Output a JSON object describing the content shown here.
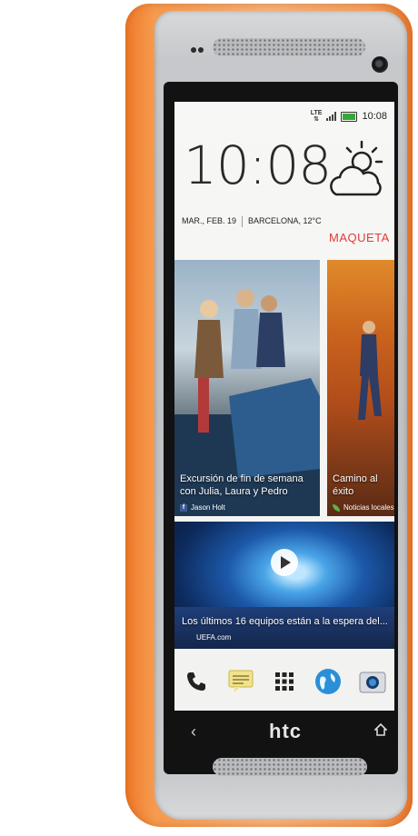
{
  "device": {
    "brand": "htc",
    "case_color": "#f08a3a"
  },
  "statusbar": {
    "network": "LTE",
    "time": "10:08",
    "battery_color": "#36a836"
  },
  "clock_widget": {
    "time": "10:08",
    "date": "MAR., FEB. 19",
    "location_temp": "BARCELONA, 12°C",
    "weather_label": "MAQUETA",
    "weather_icon": "partly-cloudy-icon"
  },
  "news_tiles": [
    {
      "caption": "Excursión de fin de semana con Julia, Laura y Pedro",
      "source": "Jason Holt",
      "source_icon": "facebook-icon"
    },
    {
      "caption": "Camino al éxito",
      "source": "Noticias locales",
      "source_icon": "leaf-icon"
    },
    {
      "caption": "Los últimos 16 equipos están a la espera del...",
      "source": "UEFA.com",
      "source_icon": "play-icon"
    }
  ],
  "dock": [
    {
      "icon": "phone-icon"
    },
    {
      "icon": "messages-icon"
    },
    {
      "icon": "app-grid-icon"
    },
    {
      "icon": "browser-globe-icon"
    },
    {
      "icon": "camera-app-icon"
    }
  ],
  "nav": {
    "back_icon": "back-icon",
    "home_icon": "home-icon"
  }
}
